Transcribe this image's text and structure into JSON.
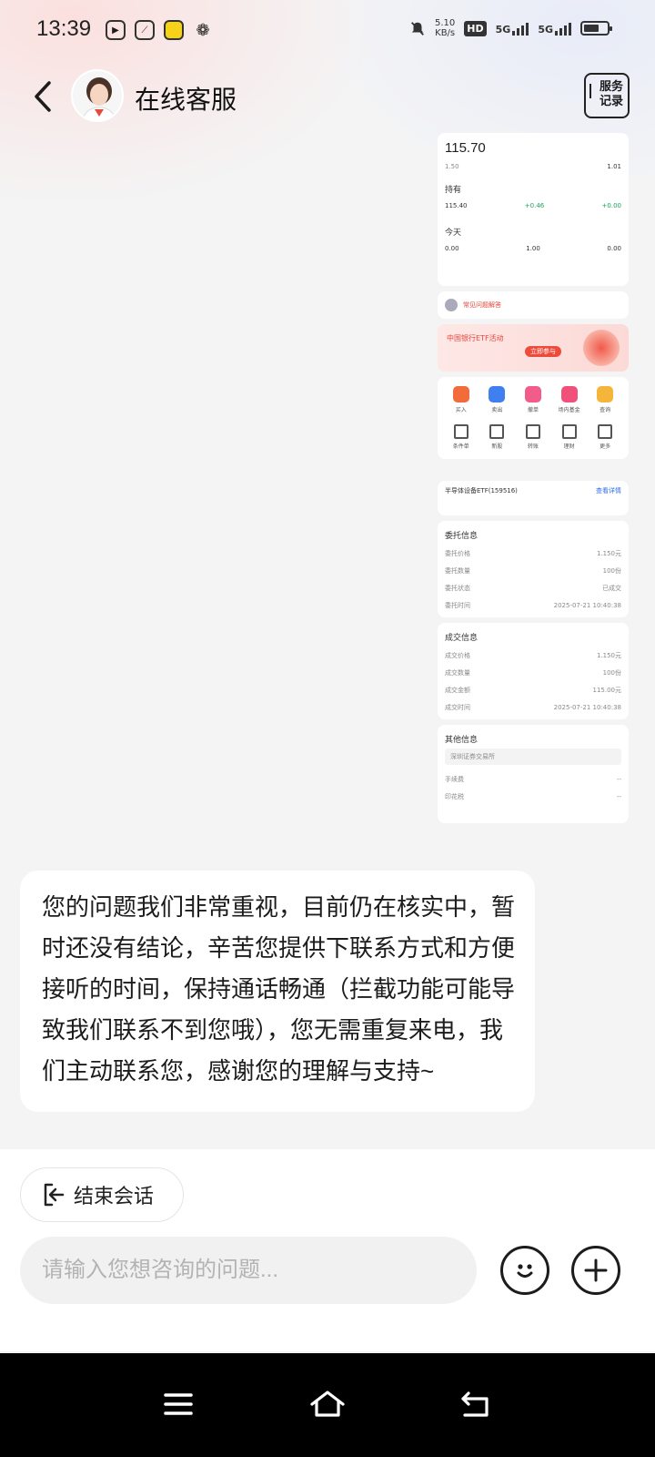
{
  "status_bar": {
    "time": "13:39",
    "speed_value": "5.10",
    "speed_unit": "KB/s",
    "hd_label": "HD",
    "sim1_net": "5G",
    "sim2_net": "5G"
  },
  "header": {
    "title": "在线客服",
    "service_record_line1": "服务",
    "service_record_line2": "记录"
  },
  "screenshot": {
    "price": "115.70",
    "row1_left": "1.50",
    "row1_right": "1.01",
    "sec1_title": "持有",
    "sec1_vals": [
      "115.40",
      "+0.46",
      "+0.00"
    ],
    "sec2_title": "今天",
    "sec2_vals": [
      "0.00",
      "1.00",
      "0.00"
    ],
    "notice_text": "常见问题解答",
    "promo_text": "中国银行ETF活动",
    "promo_btn": "立即参与",
    "grid_icons_row1": [
      "red",
      "blue",
      "pink",
      "pink",
      "yellow"
    ],
    "fund_title": "半导体设备ETF(159516)",
    "fund_link": "查看详情",
    "sec_a_title": "委托信息",
    "sec_a_rows": [
      {
        "k": "委托价格",
        "v": "1.150元"
      },
      {
        "k": "委托数量",
        "v": "100份"
      },
      {
        "k": "委托状态",
        "v": "已成交"
      },
      {
        "k": "委托时间",
        "v": "2025-07-21 10:40:38"
      }
    ],
    "sec_b_title": "成交信息",
    "sec_b_rows": [
      {
        "k": "成交价格",
        "v": "1.150元"
      },
      {
        "k": "成交数量",
        "v": "100份"
      },
      {
        "k": "成交金额",
        "v": "115.00元"
      },
      {
        "k": "成交时间",
        "v": "2025-07-21 10:40:38"
      }
    ],
    "sec_c_title": "其他信息",
    "sec_c_bar": "深圳证券交易所",
    "sec_c_rows": [
      {
        "k": "手续费",
        "v": "--"
      },
      {
        "k": "印花税",
        "v": "--"
      }
    ]
  },
  "message": {
    "text": "您的问题我们非常重视，目前仍在核实中，暂时还没有结论，辛苦您提供下联系方式和方便接听的时间，保持通话畅通（拦截功能可能导致我们联系不到您哦），您无需重复来电，我们主动联系您，感谢您的理解与支持~"
  },
  "bottom": {
    "end_chat_label": "结束会话",
    "input_placeholder": "请输入您想咨询的问题...",
    "input_value": ""
  },
  "colors": {
    "accent_red": "#ef4b3b",
    "green": "#1aa35a",
    "blue": "#2b6de6"
  }
}
